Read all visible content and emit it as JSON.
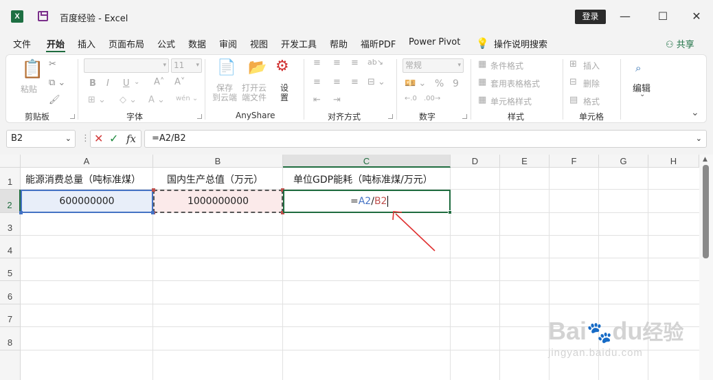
{
  "window": {
    "title": "百度经验  -  Excel",
    "login_label": "登录",
    "logo_letter": "X"
  },
  "menu": {
    "items": [
      "文件",
      "开始",
      "插入",
      "页面布局",
      "公式",
      "数据",
      "审阅",
      "视图",
      "开发工具",
      "帮助",
      "福昕PDF",
      "Power Pivot"
    ],
    "active": "开始",
    "search_label": "操作说明搜索",
    "share_label": "共享"
  },
  "ribbon": {
    "clipboard": {
      "label": "剪贴板",
      "paste": "粘贴"
    },
    "font": {
      "label": "字体",
      "size": "11",
      "bold": "B",
      "italic": "I",
      "underline": "U"
    },
    "anyshare": {
      "label": "AnyShare",
      "save_cloud": [
        "保存",
        "到云端"
      ],
      "open_cloud": [
        "打开云",
        "端文件"
      ],
      "settings": [
        "设",
        "置"
      ]
    },
    "alignment": {
      "label": "对齐方式"
    },
    "number": {
      "label": "数字",
      "format": "常规",
      "percent": "%",
      "comma": "9"
    },
    "styles": {
      "label": "样式",
      "conditional": "条件格式",
      "table": "套用表格格式",
      "cell_styles": "单元格样式"
    },
    "cells": {
      "label": "单元格",
      "insert": "插入",
      "delete": "删除",
      "format": "格式"
    },
    "editing": {
      "label": "编辑"
    }
  },
  "formula_bar": {
    "name_box": "B2",
    "formula": "=A2/B2",
    "fx": "fx"
  },
  "sheet": {
    "columns": [
      "A",
      "B",
      "C",
      "D",
      "E",
      "F",
      "G",
      "H"
    ],
    "rows": [
      "1",
      "2",
      "3",
      "4",
      "5",
      "6",
      "7",
      "8"
    ],
    "cells": {
      "A1": "能源消费总量（吨标准煤）",
      "B1": "国内生产总值（万元）",
      "C1": "单位GDP能耗（吨标准煤/万元）",
      "A2": "600000000",
      "B2": "1000000000",
      "C2_eq": "=",
      "C2_ref1": "A2",
      "C2_slash": "/",
      "C2_ref2": "B2"
    }
  },
  "watermark": {
    "text": "Bai",
    "text2": "du",
    "text3": "经验",
    "url": "jingyan.baidu.com"
  },
  "colors": {
    "accent": "#1e6b3e",
    "ref_a": "#4472c4",
    "ref_b": "#c0504d",
    "arrow": "#e03030"
  }
}
